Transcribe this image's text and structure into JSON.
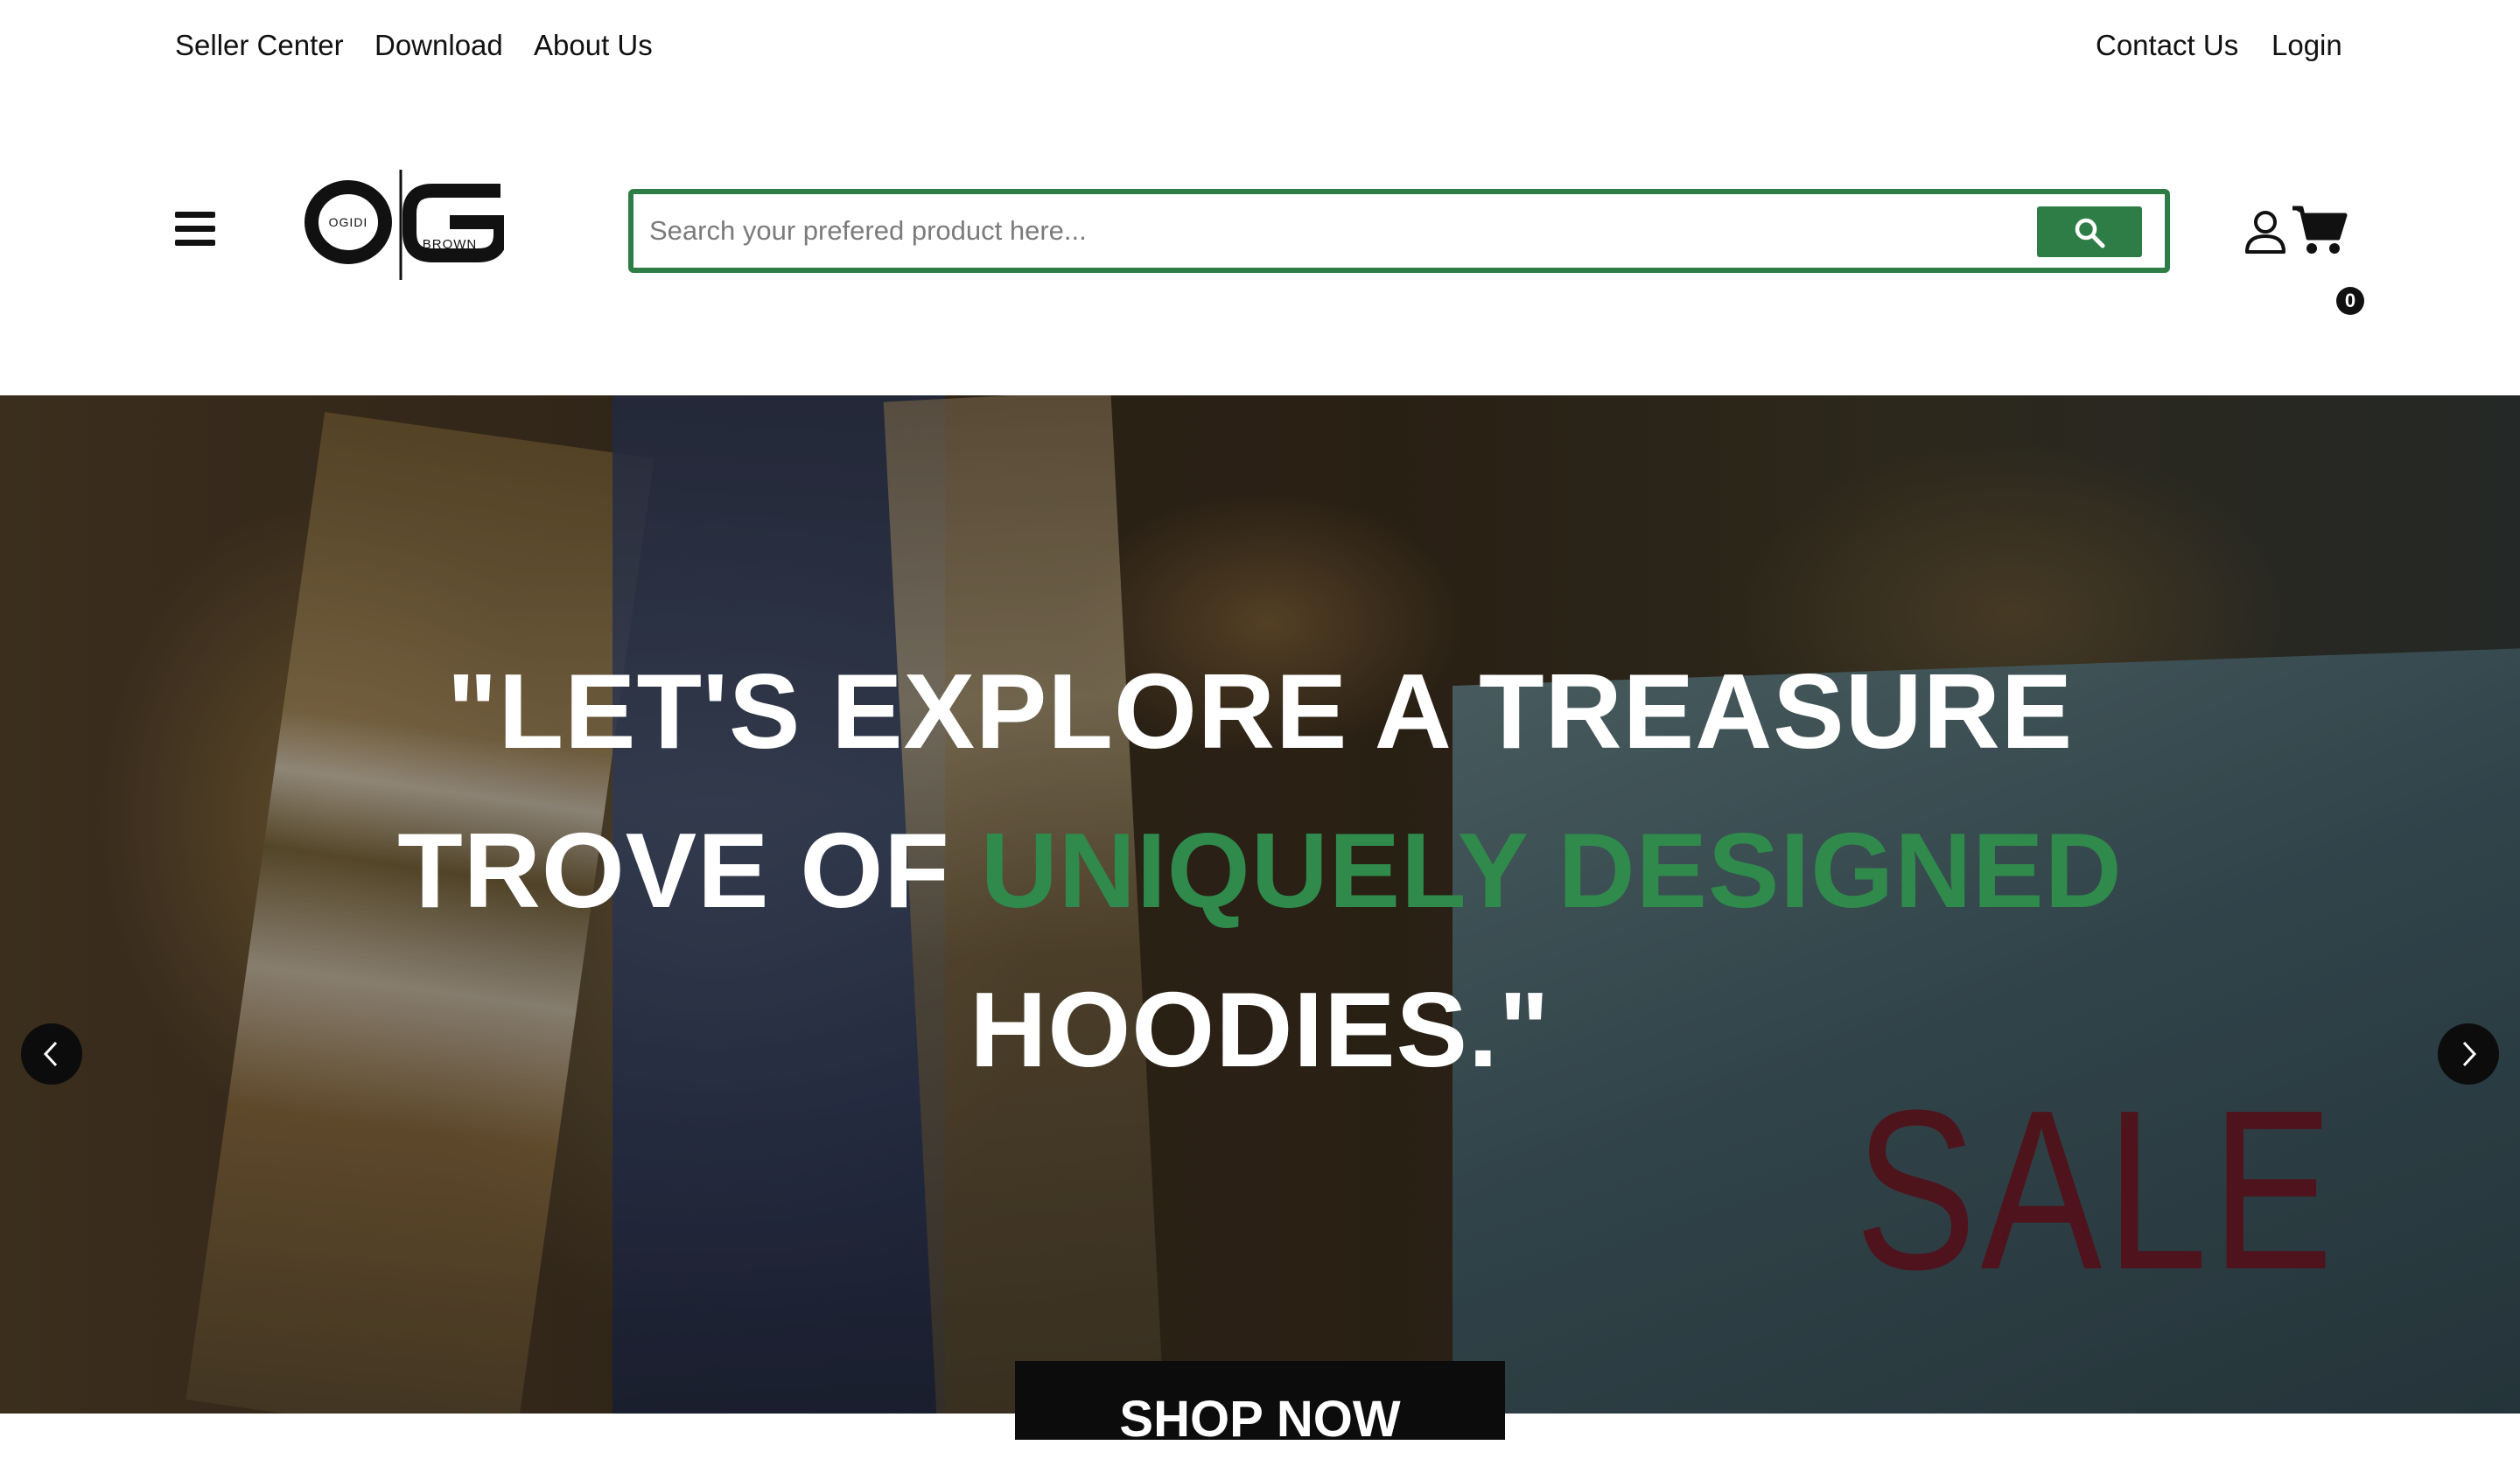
{
  "topbar": {
    "left_links": [
      "Seller Center",
      "Download",
      "About Us"
    ],
    "right_links": [
      "Contact Us",
      "Login"
    ]
  },
  "header": {
    "logo": {
      "letters": "OG",
      "top_text": "OGIDI",
      "bottom_text": "BROWN"
    },
    "search": {
      "placeholder": "Search your prefered product here..."
    },
    "cart_count": "0",
    "accent_color": "#2f7d46"
  },
  "hero": {
    "headline_line1": "\"LET'S EXPLORE A TREASURE",
    "headline_line2_prefix": "TROVE OF ",
    "headline_line2_accent": "UNIQUELY DESIGNED",
    "headline_line3": "HOODIES.\"",
    "sign_text": "SALE",
    "cta_label": "SHOP NOW",
    "accent_color": "#2f8a4c"
  }
}
